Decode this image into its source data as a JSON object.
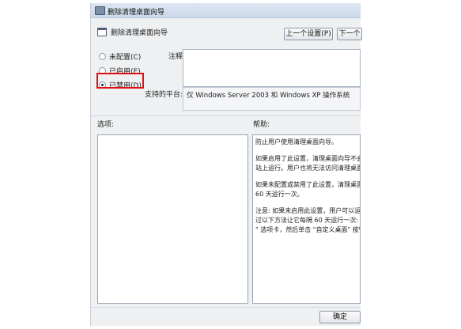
{
  "window": {
    "title": "删除清理桌面向导"
  },
  "header": {
    "title": "删除清理桌面向导",
    "prev_button": "上一个设置(P)",
    "next_button": "下一个"
  },
  "state_options": [
    {
      "label": "未配置(C)",
      "checked": false
    },
    {
      "label": "已启用(E)",
      "checked": false
    },
    {
      "label": "已禁用(D)",
      "checked": true
    }
  ],
  "comment": {
    "label": "注释:",
    "value": ""
  },
  "platform": {
    "label": "支持的平台:",
    "value": "仅 Windows Server 2003 和 Windows XP 操作系统"
  },
  "options_pane": {
    "label": "选项:"
  },
  "help_pane": {
    "label": "帮助:",
    "paragraphs": [
      "防止用户使用清理桌面向导。",
      "如果启用了此设置，清理桌面向导不会每\n站上运行。用户也将无法访问清理桌面向",
      "如果未配置或禁用了此设置，清理桌面向\n60 天运行一次。",
      "注意: 如果未启用此设置，用户可以运行\n过以下方法让它每隔 60 天运行一次: 在\n\" 选项卡，然后单击 \"自定义桌面\" 按钮"
    ]
  },
  "footer": {
    "ok_button": "确定"
  },
  "colors": {
    "highlight": "#e01010"
  }
}
